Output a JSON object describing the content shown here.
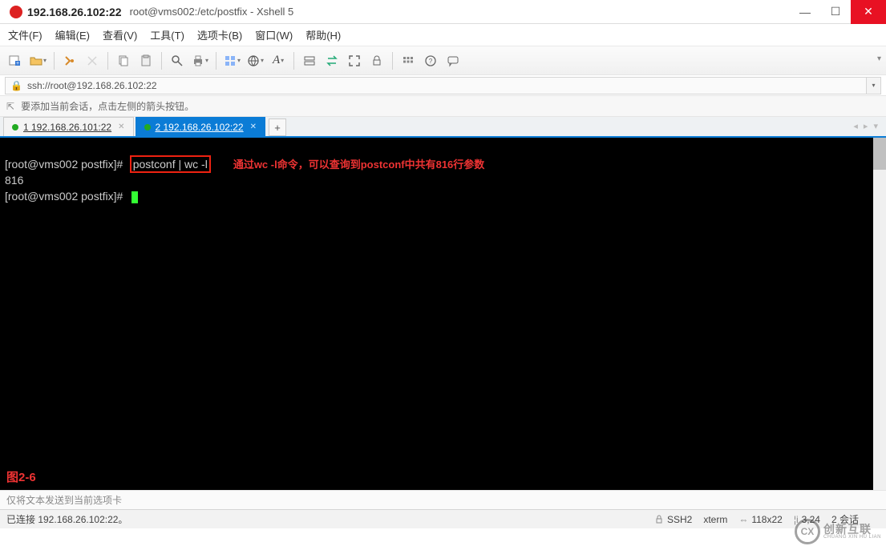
{
  "titlebar": {
    "ip": "192.168.26.102:22",
    "ext": "root@vms002:/etc/postfix - Xshell 5"
  },
  "menu": {
    "file": "文件(F)",
    "edit": "编辑(E)",
    "view": "查看(V)",
    "tools": "工具(T)",
    "tab": "选项卡(B)",
    "window": "窗口(W)",
    "help": "帮助(H)"
  },
  "address": {
    "url": "ssh://root@192.168.26.102:22"
  },
  "hint": {
    "text": "要添加当前会话，点击左侧的箭头按钮。"
  },
  "tabs": [
    {
      "label": "1 192.168.26.101:22",
      "active": false
    },
    {
      "label": "2 192.168.26.102:22",
      "active": true
    }
  ],
  "terminal": {
    "prompt1": "[root@vms002 postfix]#",
    "command1": "postconf | wc -l",
    "annotation": "通过wc -l命令，可以查询到postconf中共有816行参数",
    "output1": "816",
    "prompt2": "[root@vms002 postfix]#",
    "figLabel": "图2-6"
  },
  "sendbar": {
    "text": "仅将文本发送到当前选项卡"
  },
  "status": {
    "connection": "已连接 192.168.26.102:22。",
    "proto": "SSH2",
    "termType": "xterm",
    "size": "118x22",
    "pos": "3,24",
    "sessions": "2 会话"
  },
  "watermark": {
    "cx": "CX",
    "cn": "创新互联",
    "en": "CHUANG XIN HU LIAN"
  }
}
